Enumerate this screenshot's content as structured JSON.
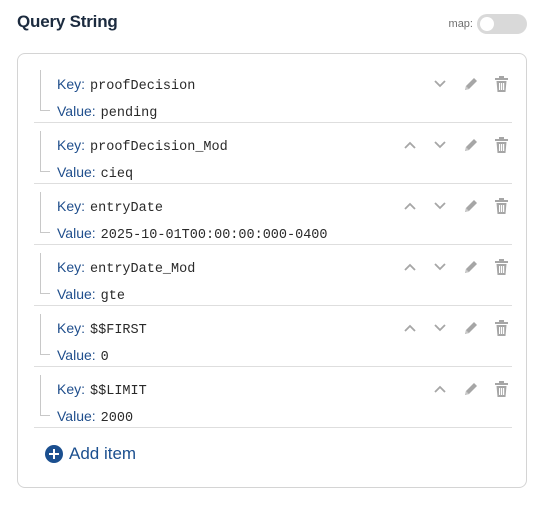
{
  "header": {
    "title": "Query String",
    "map_label": "map:",
    "map_enabled": false
  },
  "labels": {
    "key": "Key:",
    "value": "Value:"
  },
  "items": [
    {
      "key": "proofDecision",
      "value": "pending",
      "can_move_up": false,
      "can_move_down": true
    },
    {
      "key": "proofDecision_Mod",
      "value": "cieq",
      "can_move_up": true,
      "can_move_down": true
    },
    {
      "key": "entryDate",
      "value": "2025-10-01T00:00:00:000-0400",
      "can_move_up": true,
      "can_move_down": true
    },
    {
      "key": "entryDate_Mod",
      "value": "gte",
      "can_move_up": true,
      "can_move_down": true
    },
    {
      "key": "$$FIRST",
      "value": "0",
      "can_move_up": true,
      "can_move_down": true
    },
    {
      "key": "$$LIMIT",
      "value": "2000",
      "can_move_up": true,
      "can_move_down": false
    }
  ],
  "icons": {
    "move_up": "chevron-up-icon",
    "move_down": "chevron-down-icon",
    "edit": "pencil-icon",
    "delete": "trash-icon",
    "add": "plus-circle-icon"
  },
  "add_item_label": "Add item",
  "colors": {
    "accent": "#1b4f8f",
    "label": "#1f4e8c",
    "icon": "#a6a6a6",
    "toggle_off": "#d9d9d9"
  }
}
